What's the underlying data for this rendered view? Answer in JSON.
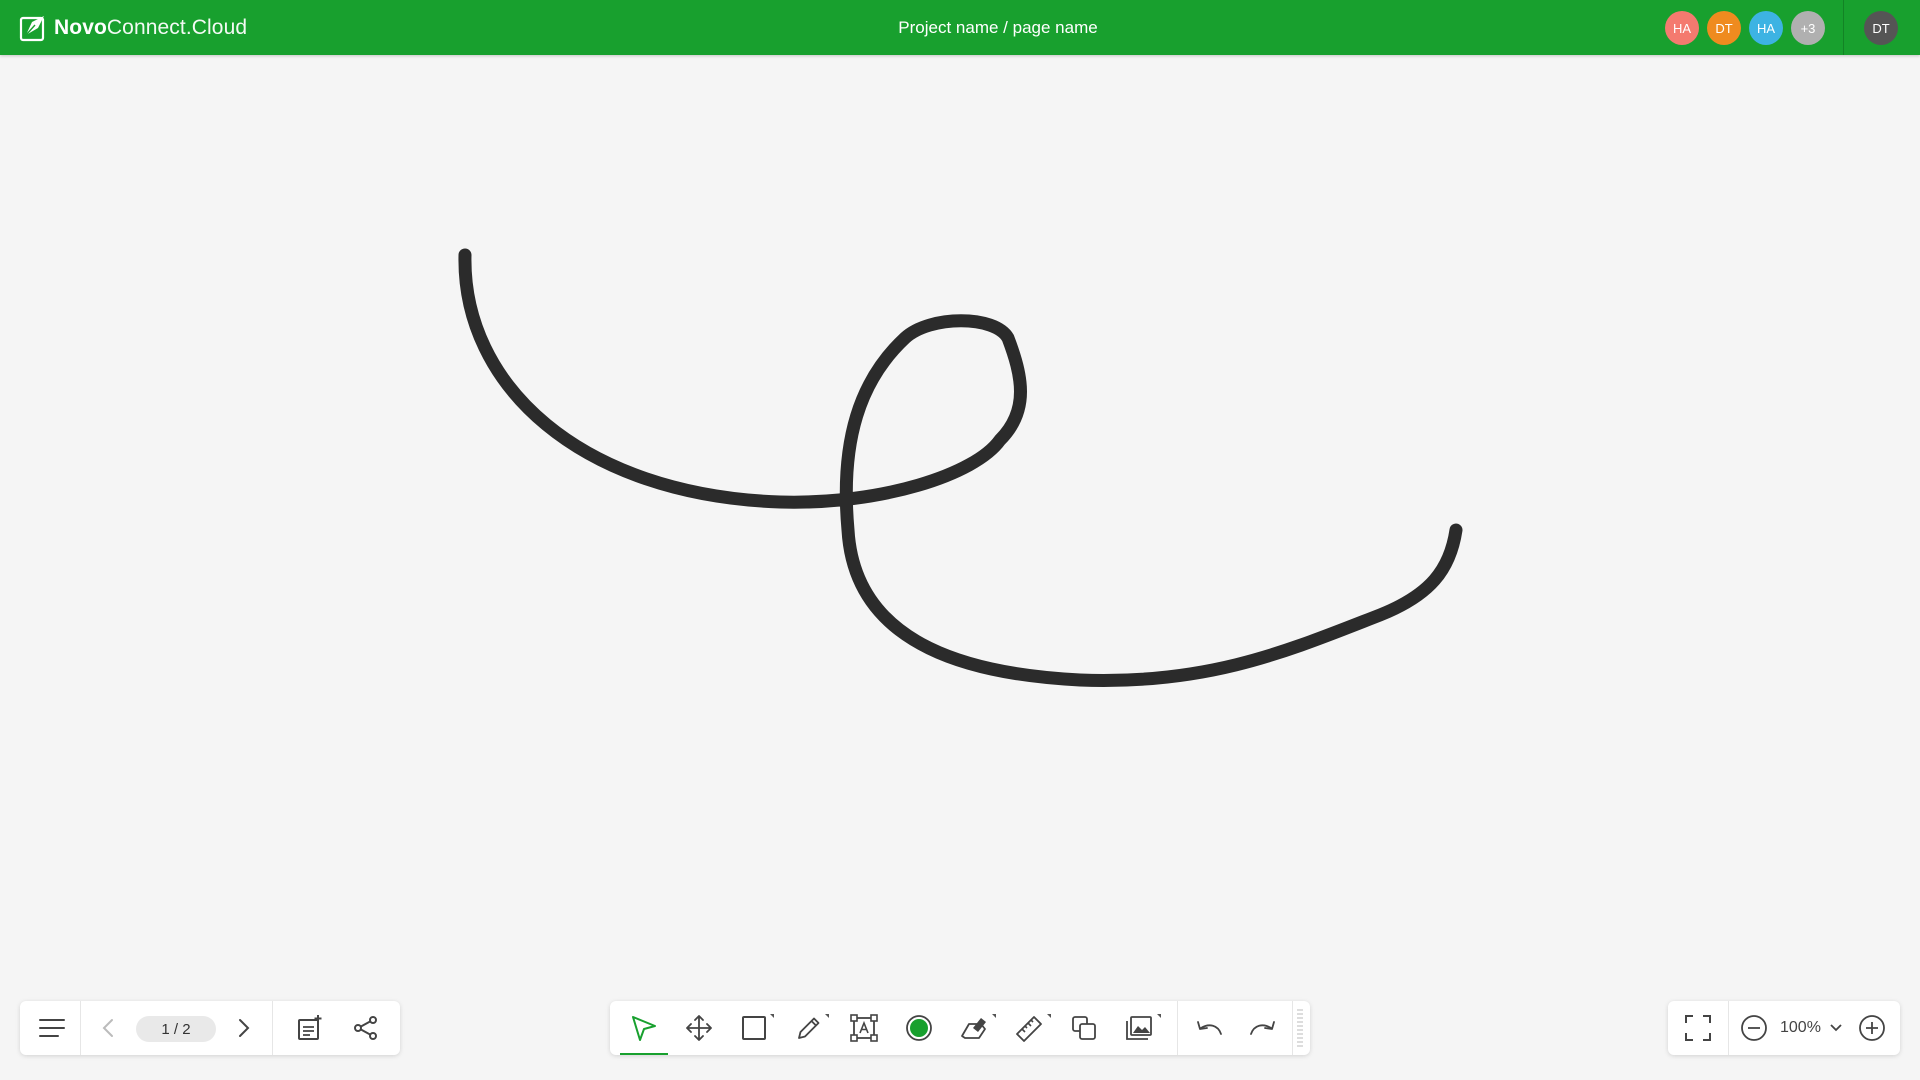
{
  "app": {
    "logo_part1": "Novo",
    "logo_part2": "Connect.Cloud",
    "title": "Project name / page name"
  },
  "participants": [
    {
      "initials": "HA",
      "color": "#f47a6f"
    },
    {
      "initials": "DT",
      "color": "#ef8b1f"
    },
    {
      "initials": "HA",
      "color": "#3db3e3"
    },
    {
      "initials": "+3",
      "color": "#b0b0b0"
    }
  ],
  "current_user": {
    "initials": "DT",
    "color": "#555555"
  },
  "pagination": {
    "label": "1 / 2"
  },
  "zoom": {
    "label": "100%"
  },
  "colors": {
    "brand": "#18a02e",
    "active_pen_color": "#18a02e",
    "stroke": "#2b2b2b"
  },
  "tools": {
    "left": [
      "menu-icon",
      "prev-page-icon",
      "next-page-icon",
      "add-page-icon",
      "share-icon"
    ],
    "center": [
      "select-icon",
      "pan-icon",
      "shape-icon",
      "pen-icon",
      "text-icon",
      "color-icon",
      "eraser-icon",
      "ruler-icon",
      "layers-icon",
      "image-icon",
      "undo-icon",
      "redo-icon"
    ],
    "right": [
      "fullscreen-icon",
      "zoom-out-icon",
      "zoom-in-icon"
    ],
    "active": "select-icon"
  }
}
